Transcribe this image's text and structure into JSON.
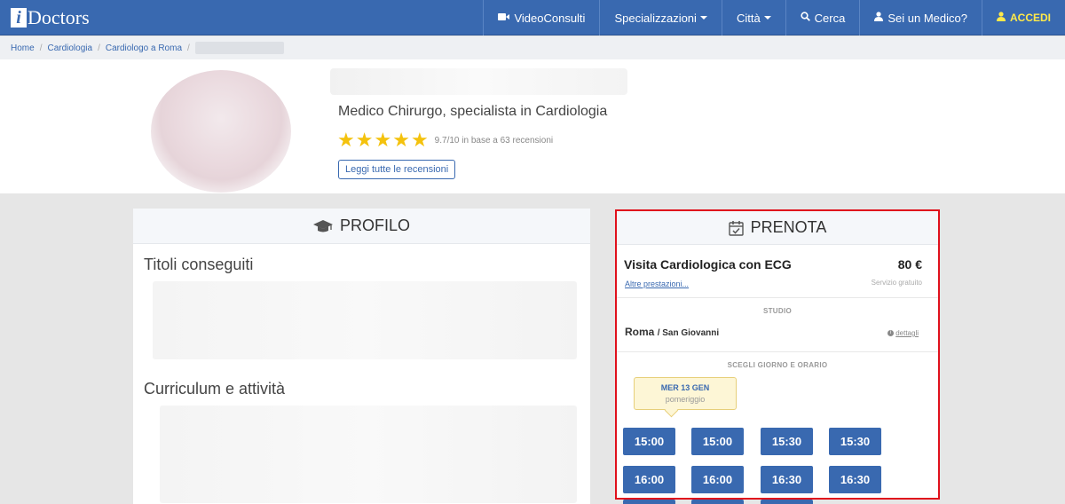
{
  "navbar": {
    "logo_i": "i",
    "logo_text": "Doctors",
    "items": [
      {
        "label": "VideoConsulti",
        "icon": "video-camera-icon"
      },
      {
        "label": "Specializzazioni",
        "icon": "caret-down-icon"
      },
      {
        "label": "Città",
        "icon": "caret-down-icon"
      },
      {
        "label": "Cerca",
        "icon": "search-icon"
      },
      {
        "label": "Sei un Medico?",
        "icon": "user-doctor-icon"
      },
      {
        "label": "ACCEDI",
        "icon": "user-icon"
      }
    ]
  },
  "breadcrumb": [
    "Home",
    "Cardiologia",
    "Cardiologo a Roma"
  ],
  "profile": {
    "specialty": "Medico Chirurgo, specialista in Cardiologia",
    "stars": 5,
    "rating_text": "9.7/10 in base a 63 recensioni",
    "reviews_button": "Leggi tutte le recensioni"
  },
  "profilo_panel": {
    "title": "PROFILO",
    "section1": "Titoli conseguiti",
    "section2": "Curriculum e attività"
  },
  "prenota_panel": {
    "title": "PRENOTA",
    "visit_name": "Visita Cardiologica con ECG",
    "price": "80 €",
    "altre": "Altre prestazioni...",
    "gratuito": "Servizio gratuito",
    "studio_label": "STUDIO",
    "city": "Roma",
    "district": "/ San Giovanni",
    "dettagli": "dettagli",
    "choose_label": "SCEGLI GIORNO E ORARIO",
    "day": "MER 13 GEN",
    "period": "pomeriggio",
    "slots": [
      "15:00",
      "15:00",
      "15:30",
      "15:30",
      "16:00",
      "16:00",
      "16:30",
      "16:30"
    ]
  },
  "colors": {
    "brand_blue": "#3969b0",
    "accedi_yellow": "#ffe94a",
    "highlight_red": "#e0101c",
    "star_gold": "#f4c20d"
  }
}
